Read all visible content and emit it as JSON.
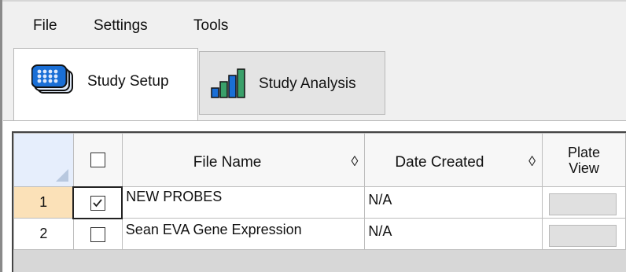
{
  "menu": {
    "file": "File",
    "settings": "Settings",
    "tools": "Tools"
  },
  "tabs": [
    {
      "label": "Study Setup",
      "icon": "plate-grid-icon",
      "active": true
    },
    {
      "label": "Study Analysis",
      "icon": "bar-chart-icon",
      "active": false
    }
  ],
  "table": {
    "headers": {
      "file_name": "File Name",
      "date_created": "Date Created",
      "plate_view_line1": "Plate",
      "plate_view_line2": "View"
    },
    "rows": [
      {
        "num": "1",
        "checked": true,
        "file_name": "NEW PROBES",
        "date_created": "N/A",
        "selected": true
      },
      {
        "num": "2",
        "checked": false,
        "file_name": "Sean EVA Gene Expression",
        "date_created": "N/A",
        "selected": false
      }
    ]
  },
  "colors": {
    "selected_row": "#fbe1b8",
    "corner": "#e6eefc",
    "accent_blue": "#1a6fd6",
    "bar_green": "#3aa06a"
  }
}
